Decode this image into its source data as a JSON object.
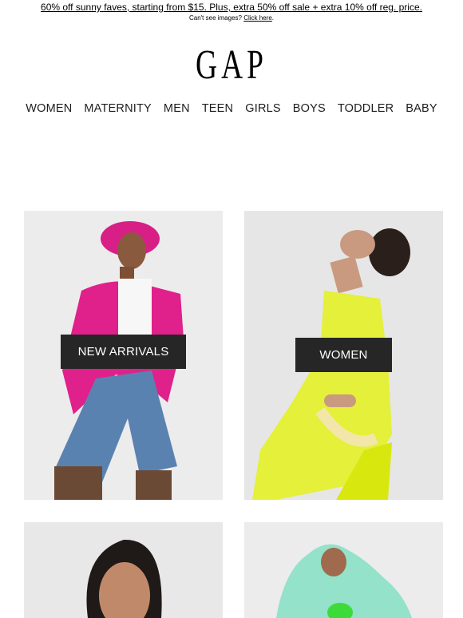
{
  "promo": {
    "text": "60% off sunny faves, starting from $15. Plus, extra 50% off sale + extra 10% off reg. price.",
    "cant_see": "Can't see images?",
    "click_here": "Click here"
  },
  "brand": {
    "logo": "GAP"
  },
  "nav": {
    "items": [
      "WOMEN",
      "MATERNITY",
      "MEN",
      "TEEN",
      "GIRLS",
      "BOYS",
      "TODDLER",
      "BABY"
    ]
  },
  "tiles": [
    {
      "cta": "NEW ARRIVALS",
      "accent": "#e31c8a"
    },
    {
      "cta": "WOMEN",
      "accent": "#e4f03a"
    },
    {
      "cta": "",
      "accent": "#262626"
    },
    {
      "cta": "",
      "accent": "#8fe3c9"
    }
  ],
  "colors": {
    "cta_bg": "#262626",
    "tile_bg": "#e9e9e9"
  }
}
